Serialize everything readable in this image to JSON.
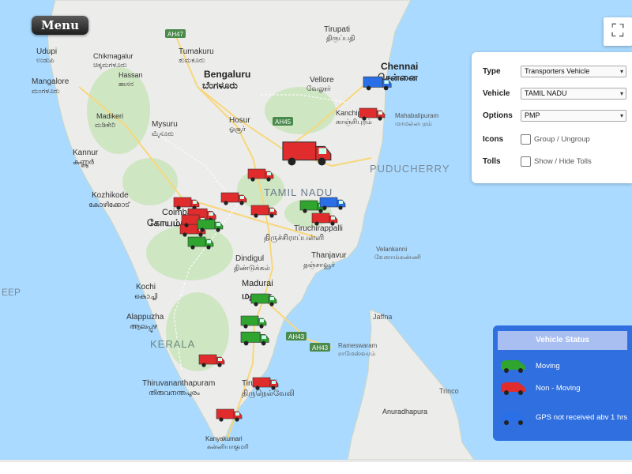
{
  "menu_label": "Menu",
  "fullscreen_icon": "fullscreen-icon",
  "filters": {
    "type_label": "Type",
    "type_value": "Transporters Vehicle",
    "vehicle_label": "Vehicle",
    "vehicle_value": "TAMIL NADU",
    "options_label": "Options",
    "options_value": "PMP",
    "icons_label": "Icons",
    "icons_check": "Group / Ungroup",
    "tolls_label": "Tolls",
    "tolls_check": "Show / Hide Tolls"
  },
  "status": {
    "title": "Vehicle Status",
    "items": [
      {
        "label": "Moving",
        "color": "#2fa52f"
      },
      {
        "label": "Non - Moving",
        "color": "#e02c2c"
      },
      {
        "label": "GPS not received abv 1 hrs",
        "color": "#2b6fe6"
      }
    ]
  },
  "map_labels": {
    "tirupati": "Tirupati",
    "tirupati_ta": "திருப்பதி",
    "chennai": "Chennai",
    "chennai_ta": "சென்னை",
    "udupi": "Udupi",
    "udupi_kn": "ಉಡುಪಿ",
    "chikmagalur": "Chikmagalur",
    "chikmagalur_kn": "ಚಿಕ್ಕಮಗಳೂರು",
    "tumakuru": "Tumakuru",
    "tumakuru_kn": "ತುಮಕೂರು",
    "bengaluru": "Bengaluru",
    "bengaluru_kn": "ಬೆಂಗಳೂರು",
    "vellore": "Vellore",
    "vellore_ta": "வேலூர்",
    "mangalore": "Mangalore",
    "mangalore_kn": "ಮಂಗಳೂರು",
    "hassan": "Hassan",
    "hassan_kn": "ಹಾಸನ",
    "kanchipuram": "Kanchipuram",
    "kanchipuram_ta": "காஞ்சிபுரம்",
    "mahabalipuram": "Mahabalipuram",
    "mahabalipuram_ta": "மாமல்லபுரம்",
    "madikeri": "Madikeri",
    "madikeri_kn": "ಮಡಿಕೇರಿ",
    "mysuru": "Mysuru",
    "mysuru_kn": "ಮೈಸೂರು",
    "hosur": "Hosur",
    "hosur_ta": "ஓசூர்",
    "kannur": "Kannur",
    "kannur_ml": "കണ്ണൂർ",
    "puducherry": "PUDUCHERRY",
    "kozhikode": "Kozhikode",
    "kozhikode_ml": "കോഴിക്കോട്",
    "tamil_nadu": "TAMIL NADU",
    "coimbatore": "Coimbatore",
    "coimbatore_ta": "கோயம்புத்தூர்",
    "tiruchirappalli": "Tiruchirappalli",
    "tiruchirappalli_ta": "திருச்சிராப்பள்ளி",
    "thanjavur": "Thanjavur",
    "thanjavur_ta": "தஞ்சாவூர்",
    "velankanni": "Velankanni",
    "velankanni_ta": "வேளாங்கண்ணி",
    "dindigul": "Dindigul",
    "dindigul_ta": "திண்டுக்கல்",
    "deep": "EEP",
    "kochi": "Kochi",
    "kochi_ml": "കൊച്ചി",
    "madurai": "Madurai",
    "madurai_ta": "மதுரை",
    "alappuzha": "Alappuzha",
    "alappuzha_ml": "ആലപ്പുഴ",
    "jaffna": "Jaffna",
    "kerala": "KERALA",
    "rameswaram": "Rameswaram",
    "rameswaram_ta": "ராமேஸ்வரம்",
    "thiruvananthapuram": "Thiruvananthapuram",
    "thiruvananthapuram_ml": "തിരുവനന്തപുരം",
    "tirunelveli": "Tirunelveli",
    "tirunelveli_ta": "திருநெல்வேலி",
    "trinco": "Trinco",
    "anuradhapura": "Anuradhapura",
    "kanyakumari": "Kanyakumari",
    "kanyakumari_ta": "கன்னியாகுமரி",
    "ah47": "AH47",
    "ah45": "AH45",
    "ah43a": "AH43",
    "ah43b": "AH43"
  }
}
